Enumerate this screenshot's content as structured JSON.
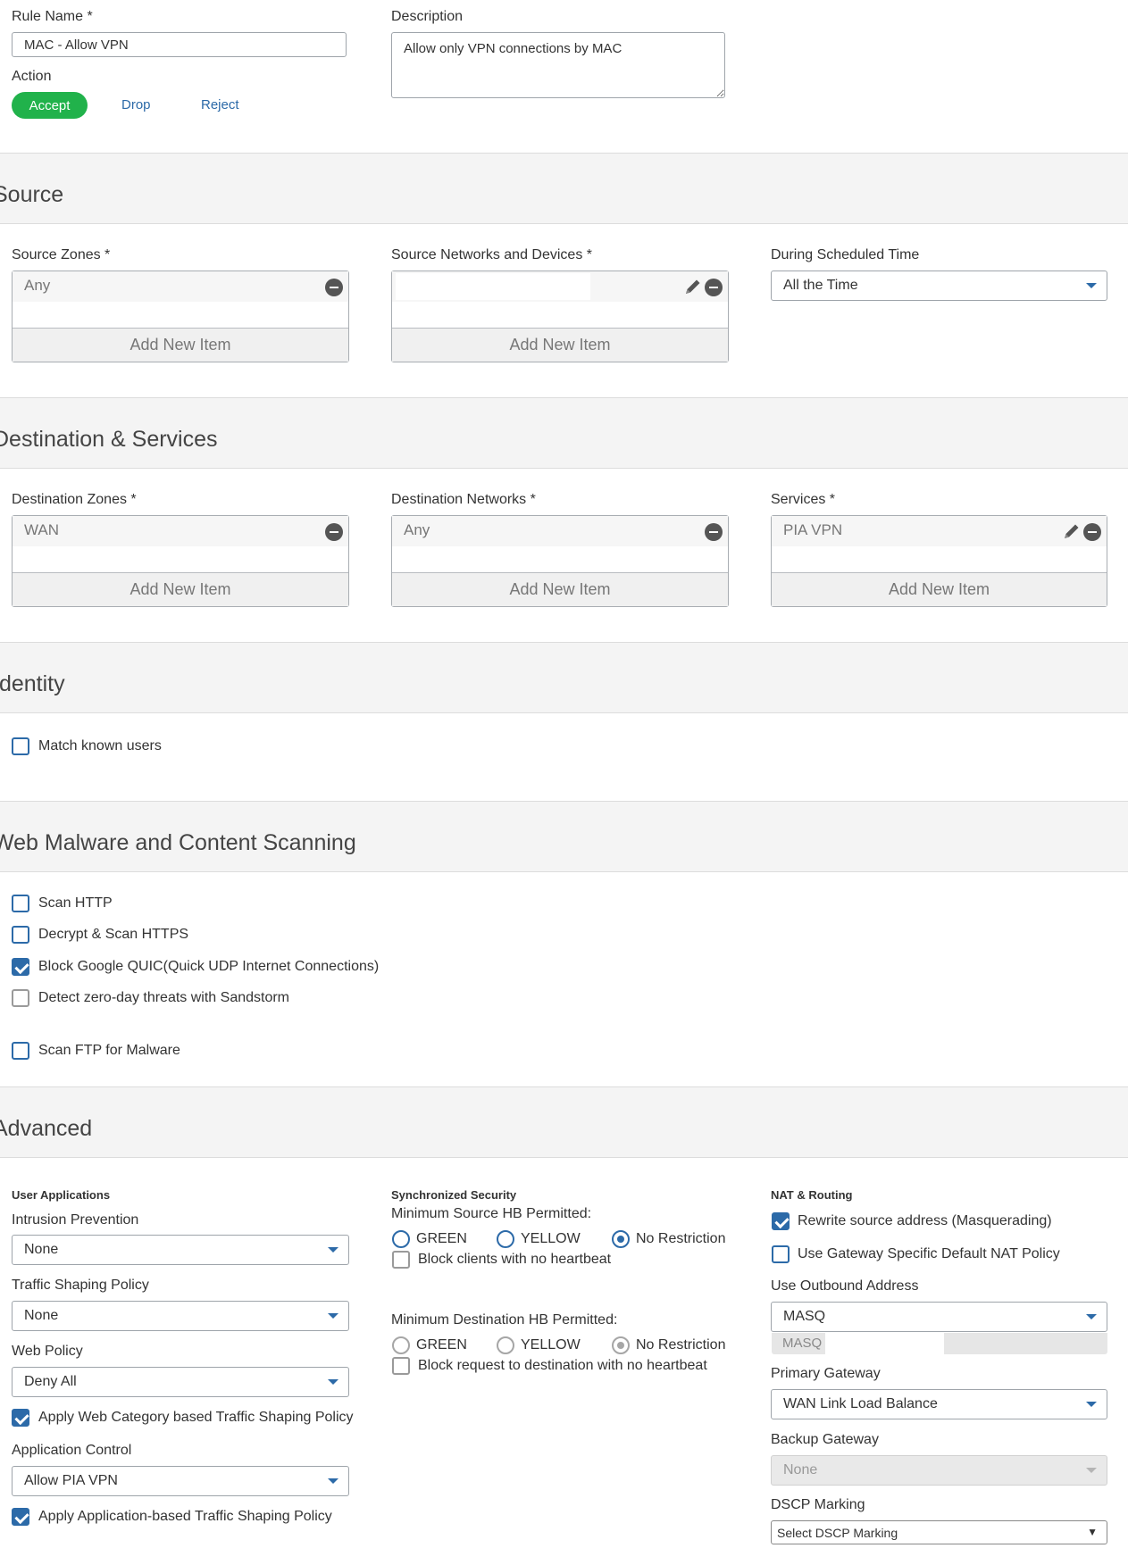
{
  "rule": {
    "name_label": "Rule Name *",
    "name_value": "MAC - Allow VPN",
    "description_label": "Description",
    "description_value": "Allow only VPN connections by MAC",
    "action_label": "Action",
    "actions": [
      "Accept",
      "Drop",
      "Reject"
    ],
    "selected_action": "Accept"
  },
  "source": {
    "title": "Source",
    "zones_label": "Source Zones *",
    "zones_value": "Any",
    "networks_label": "Source Networks and Devices *",
    "networks_value": "",
    "schedule_label": "During Scheduled Time",
    "schedule_value": "All the Time",
    "add_item": "Add New Item"
  },
  "destination": {
    "title": "Destination & Services",
    "zones_label": "Destination Zones *",
    "zones_value": "WAN",
    "networks_label": "Destination Networks *",
    "networks_value": "Any",
    "services_label": "Services *",
    "services_value": "PIA VPN",
    "add_item": "Add New Item"
  },
  "identity": {
    "title": "Identity",
    "match_known_users": {
      "label": "Match known users",
      "checked": false
    }
  },
  "scanning": {
    "title": "Web Malware and Content Scanning",
    "items": [
      {
        "label": "Scan HTTP",
        "checked": false
      },
      {
        "label": "Decrypt & Scan HTTPS",
        "checked": false
      },
      {
        "label": "Block Google QUIC(Quick UDP Internet Connections)",
        "checked": true
      },
      {
        "label": "Detect zero-day threats with Sandstorm",
        "checked": false
      },
      {
        "label": "Scan FTP for Malware",
        "checked": false
      }
    ]
  },
  "advanced": {
    "title": "Advanced",
    "user_apps": {
      "heading": "User Applications",
      "ips_label": "Intrusion Prevention",
      "ips_value": "None",
      "shaping_label": "Traffic Shaping Policy",
      "shaping_value": "None",
      "web_label": "Web Policy",
      "web_value": "Deny All",
      "web_shaping": "Apply Web Category based Traffic Shaping Policy",
      "appctrl_label": "Application Control",
      "appctrl_value": "Allow PIA VPN",
      "app_shaping": "Apply Application-based Traffic Shaping Policy"
    },
    "sync": {
      "heading": "Synchronized Security",
      "min_source": "Minimum Source HB Permitted:",
      "min_dest": "Minimum Destination HB Permitted:",
      "opt_green": "GREEN",
      "opt_yellow": "YELLOW",
      "opt_norestrict": "No Restriction",
      "block_clients": "Block clients with no heartbeat",
      "block_request": "Block request to destination with no heartbeat"
    },
    "nat": {
      "heading": "NAT & Routing",
      "rewrite": "Rewrite source address (Masquerading)",
      "gateway_nat": "Use Gateway Specific Default NAT Policy",
      "outbound_label": "Use Outbound Address",
      "outbound_value": "MASQ",
      "outbound_sub": "MASQ",
      "primary_label": "Primary Gateway",
      "primary_value": "WAN Link Load Balance",
      "backup_label": "Backup Gateway",
      "backup_value": "None",
      "dscp_label": "DSCP Marking",
      "dscp_value": "Select DSCP Marking"
    }
  },
  "colors": {
    "accent": "#2c6aa8",
    "accept": "#21b24b",
    "band": "#f4f4f4"
  }
}
